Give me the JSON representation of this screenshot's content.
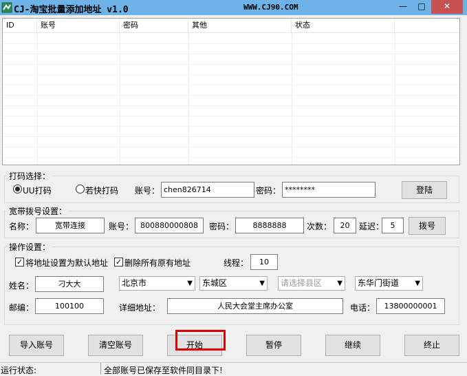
{
  "window": {
    "title": "CJ-淘宝批量添加地址 v1.0",
    "url": "WWW.CJ90.COM",
    "minimize_glyph": "—",
    "maximize_glyph": "□",
    "close_glyph": "✕",
    "title_bar_color": "#6db3e7",
    "close_color": "#c75050"
  },
  "account_list": {
    "columns": [
      "ID",
      "账号",
      "密码",
      "其他",
      "状态"
    ],
    "rows": []
  },
  "captcha": {
    "group_label": "打码选择：",
    "options": [
      {
        "label": "UU打码",
        "selected": true
      },
      {
        "label": "若快打码",
        "selected": false
      }
    ],
    "account_label": "账号：",
    "account_value": "chen826714",
    "password_label": "密码：",
    "password_value": "********",
    "login_button": "登陆"
  },
  "broadband": {
    "group_label": "宽带拨号设置：",
    "name_label": "名称：",
    "name_value": "宽带连接",
    "account_label": "账号：",
    "account_value": "800880000808",
    "password_label": "密码：",
    "password_value": "8888888",
    "count_label": "次数：",
    "count_value": "20",
    "delay_label": "延迟：",
    "delay_value": "5",
    "dial_button": "拨号"
  },
  "operation": {
    "group_label": "操作设置：",
    "default_address_label": "将地址设置为默认地址",
    "default_address_checked": true,
    "delete_all_label": "删除所有原有地址",
    "delete_all_checked": true,
    "threads_label": "线程：",
    "threads_value": "10",
    "name_label": "姓名：",
    "name_value": "刁大大",
    "province": "北京市",
    "city": "东城区",
    "county_placeholder": "请选择县区",
    "street": "东华门街道",
    "zip_label": "邮编：",
    "zip_value": "100100",
    "address_label": "详细地址：",
    "address_value": "人民大会堂主席办公室",
    "phone_label": "电话：",
    "phone_value": "13800000001"
  },
  "actions": {
    "import": "导入账号",
    "clear": "清空账号",
    "start": "开始",
    "pause": "暂停",
    "resume": "继续",
    "stop": "终止",
    "highlight_color": "#e00000"
  },
  "status": {
    "label": "运行状态:",
    "message": "全部账号已保存至软件同目录下!"
  }
}
